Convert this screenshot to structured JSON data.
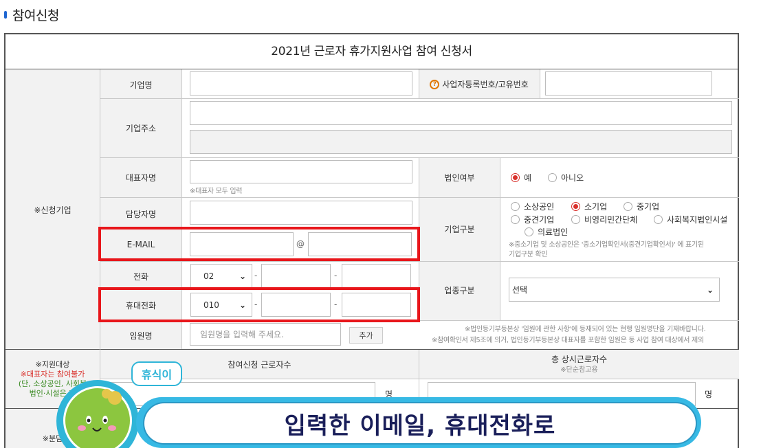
{
  "section_title": "참여신청",
  "form_title": "2021년 근로자 휴가지원사업 참여 신청서",
  "applicant_label": "※신청기업",
  "fields": {
    "company_name_label": "기업명",
    "biz_reg_label": "사업자등록번호/고유번호",
    "address_label": "기업주소",
    "ceo_label": "대표자명",
    "ceo_note": "※대표자 모두 입력",
    "corp_label": "법인여부",
    "corp_yes": "예",
    "corp_no": "아니오",
    "manager_label": "담당자명",
    "company_type_label": "기업구분",
    "company_types": [
      "소상공인",
      "소기업",
      "중기업",
      "중견기업",
      "비영리민간단체",
      "사회복지법인시설",
      "의료법인"
    ],
    "company_type_note1": "※중소기업 및 소상공인은 '중소기업확인서(중견기업확인서)' 에 표기된",
    "company_type_note2": "기업구분 확인",
    "email_label": "E-MAIL",
    "email_at": "@",
    "phone_label": "전화",
    "phone_prefix": "02",
    "industry_label": "업종구분",
    "industry_value": "선택",
    "mobile_label": "휴대전화",
    "mobile_prefix": "010",
    "dash": "-",
    "exec_label": "임원명",
    "exec_placeholder": "임원명을 입력해 주세요.",
    "exec_add_button": "추가",
    "exec_note1": "※법인등기부등본상 '임원에 관한 사항'에 등재되어 있는 현행 임원명단을 기재바랍니다.",
    "exec_note2": "※참여확인서 제5조에 의거, 법인등기부등본상 대표자를 포함한 임원은 동 사업 참여 대상에서 제외"
  },
  "support": {
    "label1": "※지원대상",
    "label2": "※대표자는 참여불가",
    "label3": "(단, 소상공인, 사회복",
    "label4": "법인·시설은 제",
    "participants_header": "참여신청 근로자수",
    "total_header": "총 상시근로자수",
    "total_note": "※단순참고용",
    "unit": "명",
    "share_label": "※분담"
  },
  "overlay": {
    "bubble_text": "휴식이",
    "caption": "입력한 이메일, 휴대전화로"
  },
  "colors": {
    "highlight_border": "#e8161b",
    "radio_selected": "#d9302b",
    "accent_blue": "#2fb5d8"
  }
}
